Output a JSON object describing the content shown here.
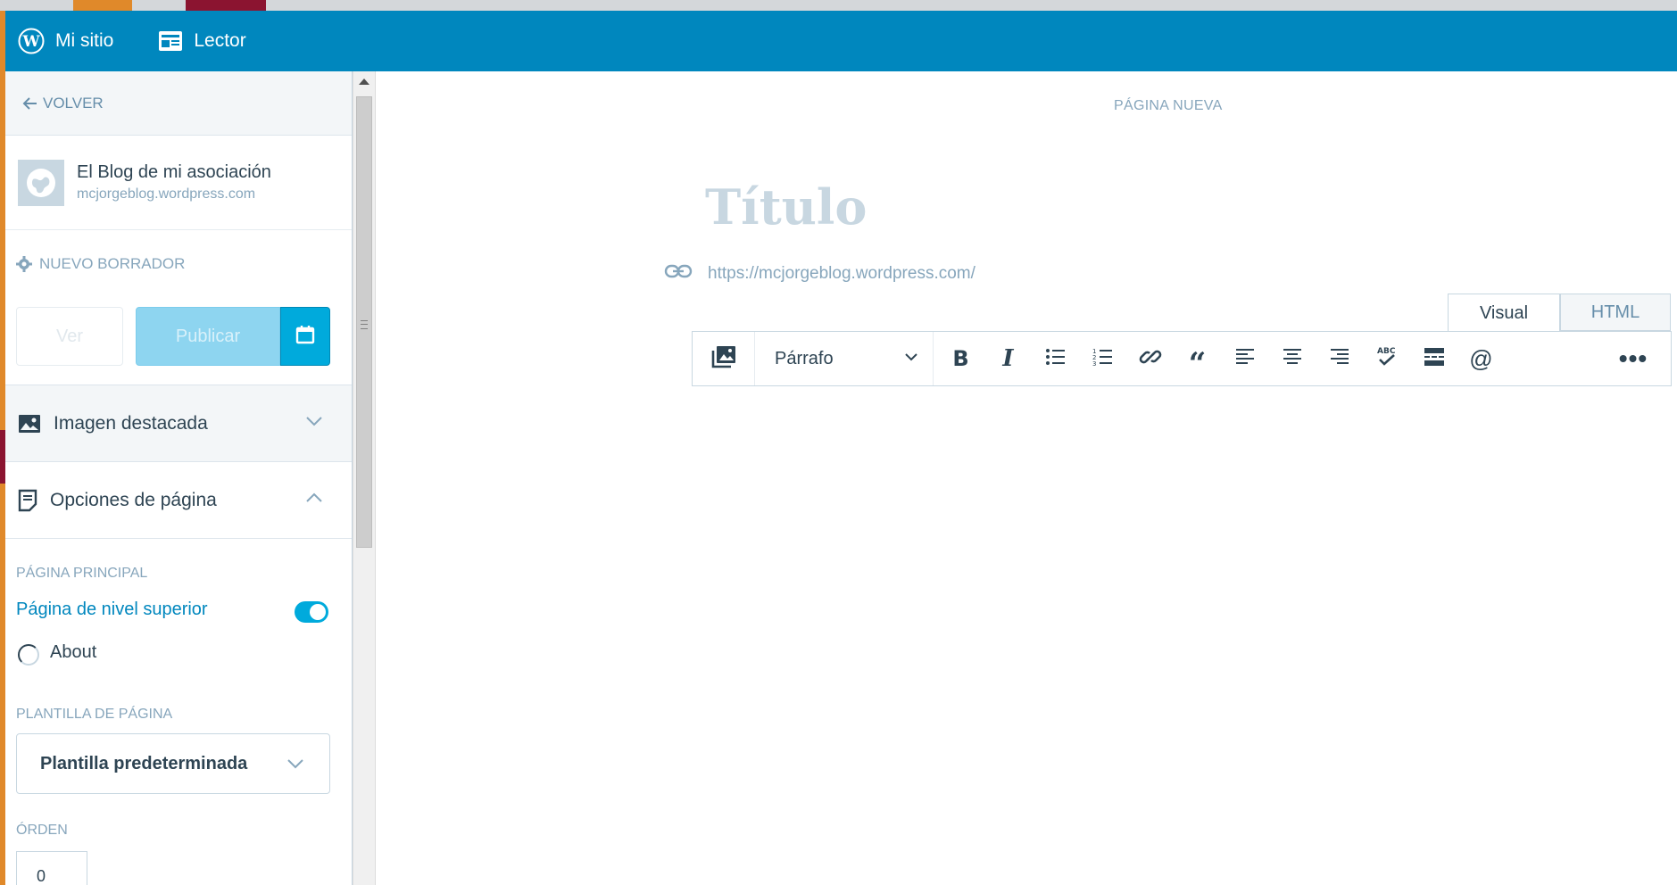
{
  "masterbar": {
    "my_site": "Mi sitio",
    "reader": "Lector"
  },
  "sidebar": {
    "back_label": "VOLVER",
    "site_title": "El Blog de mi asociación",
    "site_url": "mcjorgeblog.wordpress.com",
    "status_label": "NUEVO BORRADOR",
    "preview_button": "Ver",
    "publish_button": "Publicar",
    "featured_image_label": "Imagen destacada",
    "page_options_label": "Opciones de página",
    "parent_page_label": "PÁGINA PRINCIPAL",
    "parent_top_level": "Página de nivel superior",
    "parent_option_about": "About",
    "template_label": "PLANTILLA DE PÁGINA",
    "template_value": "Plantilla predeterminada",
    "order_label": "ÓRDEN",
    "order_value": "0"
  },
  "editor": {
    "page_kind": "PÁGINA NUEVA",
    "title_placeholder": "Título",
    "permalink": "https://mcjorgeblog.wordpress.com/",
    "tab_visual": "Visual",
    "tab_html": "HTML",
    "format_select": "Párrafo",
    "bold": "B",
    "italic": "I",
    "quote": "“",
    "mention": "@",
    "more": "•••"
  },
  "colors": {
    "masterbar": "#0087be",
    "accent": "#00aadc",
    "text": "#2e4453",
    "muted": "#87a6bc"
  }
}
